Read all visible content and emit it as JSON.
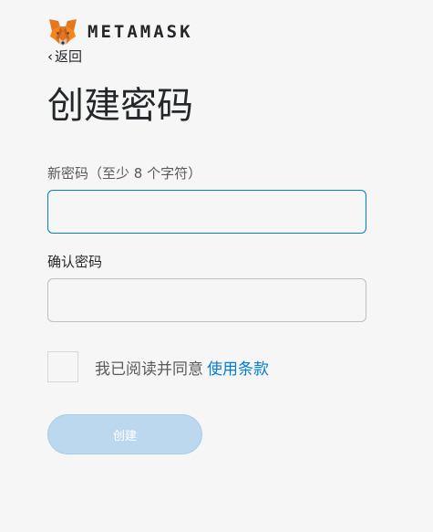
{
  "brand": {
    "logo_icon": "metamask-fox-icon",
    "wordmark": "METAMASK"
  },
  "nav": {
    "back_label": "返回",
    "back_icon": "chevron-left-icon"
  },
  "page": {
    "title": "创建密码"
  },
  "form": {
    "new_password_label": "新密码（至少 8 个字符）",
    "new_password_value": "",
    "confirm_password_label": "确认密码",
    "confirm_password_value": "",
    "terms_text": "我已阅读并同意",
    "terms_link": "使用条款",
    "terms_checked": false,
    "submit_label": "创建"
  },
  "colors": {
    "accent": "#037dd6",
    "button_disabled": "#bcd8ee",
    "background": "#f6f6f6"
  }
}
